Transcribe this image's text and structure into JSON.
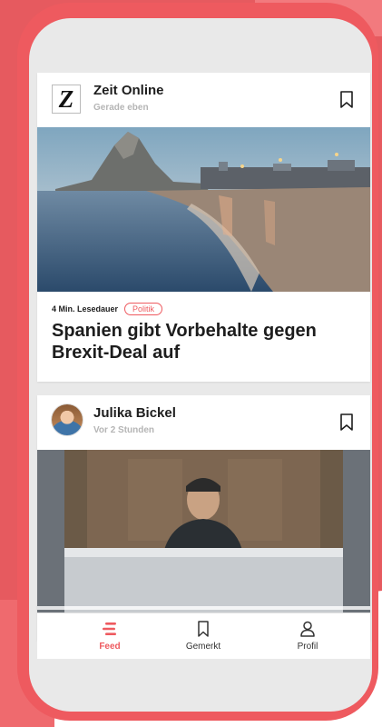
{
  "feed": {
    "cards": [
      {
        "source": "Zeit Online",
        "logo_letter": "Z",
        "time": "Gerade eben",
        "read_time": "4 Min. Lesedauer",
        "tag": "Politik",
        "headline": "Spanien gibt Vorbehalte gegen Brexit-Deal auf"
      },
      {
        "source": "Julika Bickel",
        "time": "Vor 2 Stunden"
      }
    ]
  },
  "nav": {
    "items": [
      {
        "label": "Feed",
        "icon": "feed-icon",
        "active": true
      },
      {
        "label": "Gemerkt",
        "icon": "bookmark-icon",
        "active": false
      },
      {
        "label": "Profil",
        "icon": "profile-icon",
        "active": false
      }
    ]
  },
  "colors": {
    "accent": "#ee5a5f",
    "background": "#e65a5f",
    "screen": "#e9e9e9",
    "text": "#1d1d1d",
    "muted": "#b5b5b5"
  }
}
